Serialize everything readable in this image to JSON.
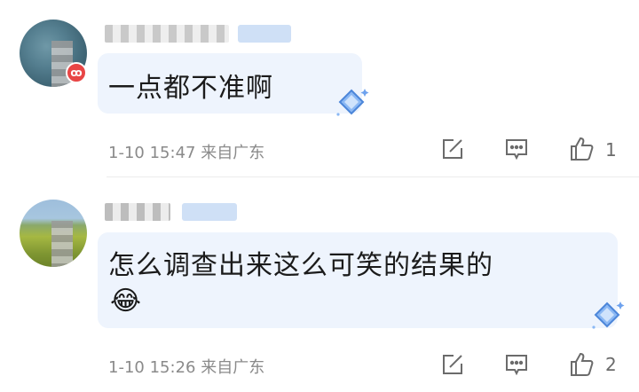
{
  "comments": [
    {
      "text": "一点都不准啊",
      "date": "1-10",
      "time": "15:47",
      "location": "来自广东",
      "likes": "1",
      "badge_icon": "weibo-badge-icon",
      "emoji": ""
    },
    {
      "text": "怎么调查出来这么可笑的结果的",
      "date": "1-10",
      "time": "15:26",
      "location": "来自广东",
      "likes": "2",
      "badge_icon": "",
      "emoji": "😂"
    }
  ],
  "icons": {
    "share": "share-icon",
    "reply": "reply-icon",
    "like": "thumbs-up-icon",
    "bubble_decor": "diamond-sparkle-icon"
  },
  "colors": {
    "bubble_bg": "#eef4fd",
    "meta_text": "#8a8a8a",
    "badge": "#e84545",
    "tag": "#cfe0f6"
  }
}
